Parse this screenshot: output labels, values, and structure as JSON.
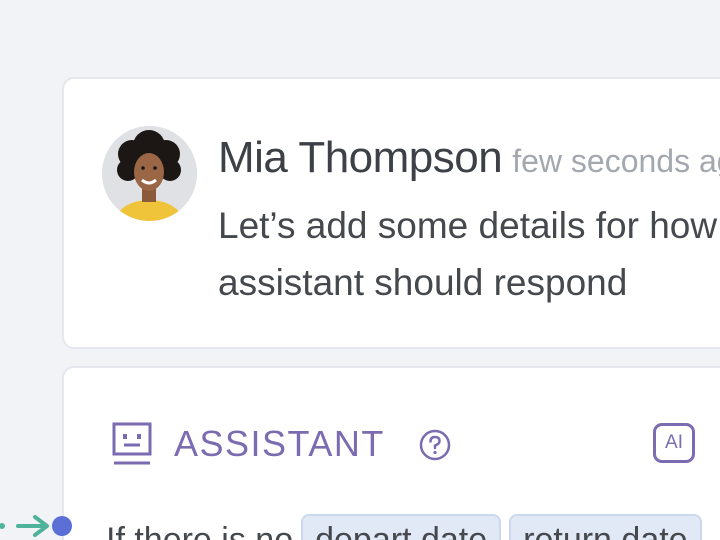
{
  "comment": {
    "author": "Mia Thompson",
    "timestamp": "few seconds ago",
    "message_line1": "Let’s add some details for how the",
    "message_line2": "assistant should respond"
  },
  "assistant": {
    "label": "ASSISTANT",
    "help_icon": "help-circle-icon",
    "badge": "AI",
    "rule_text": "If there is no",
    "chips": [
      "depart date",
      "return date"
    ]
  },
  "colors": {
    "accent": "#7b6bb0",
    "connector": "#4fb39b",
    "connector_dot": "#5b6fd6",
    "chip_bg": "#e2e9f6"
  }
}
